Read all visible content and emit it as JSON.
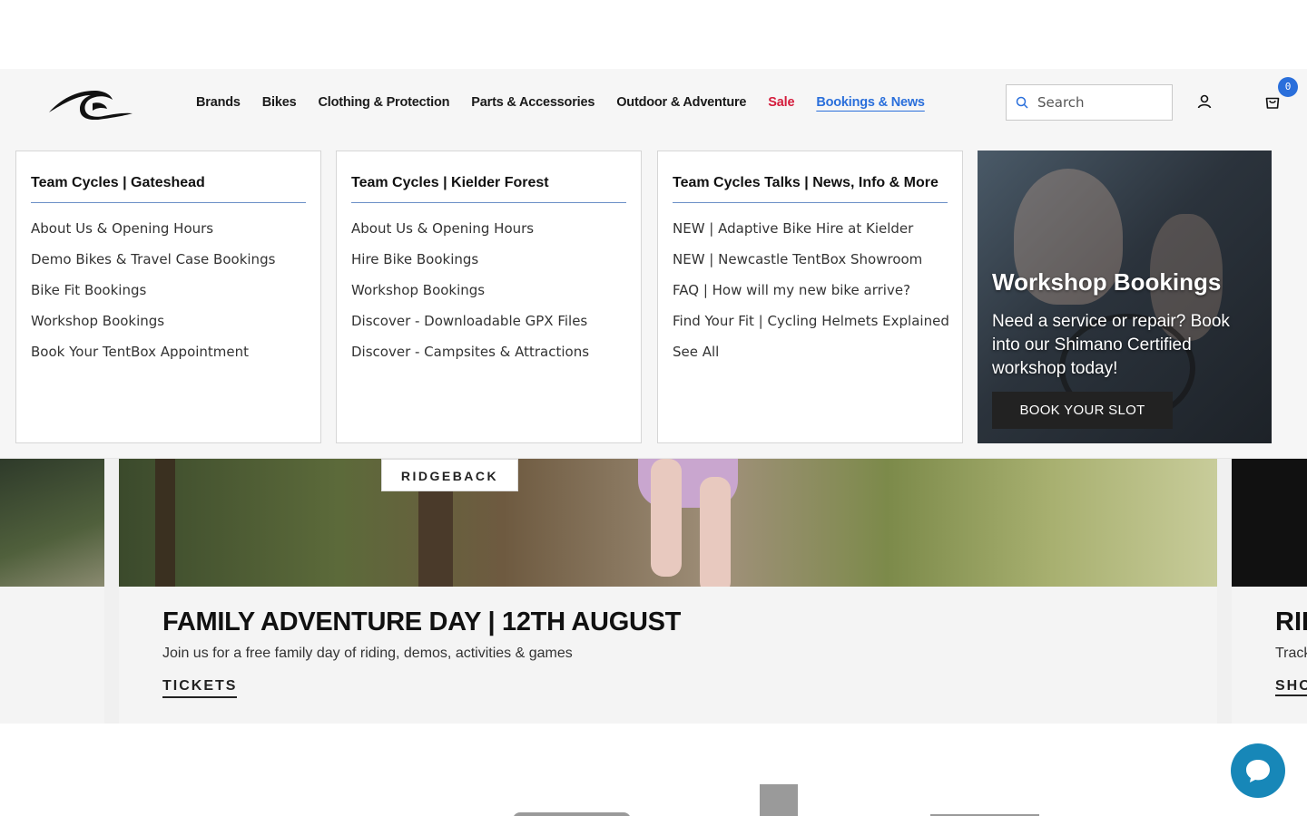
{
  "header": {
    "nav": [
      "Brands",
      "Bikes",
      "Clothing & Protection",
      "Parts & Accessories",
      "Outdoor & Adventure",
      "Sale",
      "Bookings & News"
    ],
    "search_placeholder": "Search",
    "cart_count": "0"
  },
  "mega_menu": {
    "columns": [
      {
        "title": "Team Cycles | Gateshead",
        "items": [
          "About Us & Opening Hours",
          "Demo Bikes & Travel Case Bookings",
          "Bike Fit Bookings",
          "Workshop Bookings",
          "Book Your TentBox Appointment"
        ]
      },
      {
        "title": "Team Cycles | Kielder Forest",
        "items": [
          "About Us & Opening Hours",
          "Hire Bike Bookings",
          "Workshop Bookings",
          "Discover - Downloadable GPX Files",
          "Discover - Campsites & Attractions"
        ]
      },
      {
        "title": "Team Cycles Talks | News, Info & More",
        "items": [
          "NEW | Adaptive Bike Hire at Kielder",
          "NEW | Newcastle TentBox Showroom",
          "FAQ | How will my new bike arrive?",
          "Find Your Fit | Cycling Helmets Explained",
          "See All"
        ]
      }
    ],
    "promo": {
      "title": "Workshop Bookings",
      "text": "Need a service or repair? Book into our Shimano Certified workshop today!",
      "button": "BOOK YOUR SLOT"
    }
  },
  "carousel": {
    "main": {
      "badge": "RIDGEBACK",
      "title": "FAMILY ADVENTURE DAY | 12TH AUGUST",
      "description": "Join us for a free family day of riding, demos, activities & games",
      "cta": "TICKETS"
    },
    "next_peek": {
      "title": "RID",
      "description": "Track",
      "cta": "SHO"
    }
  }
}
